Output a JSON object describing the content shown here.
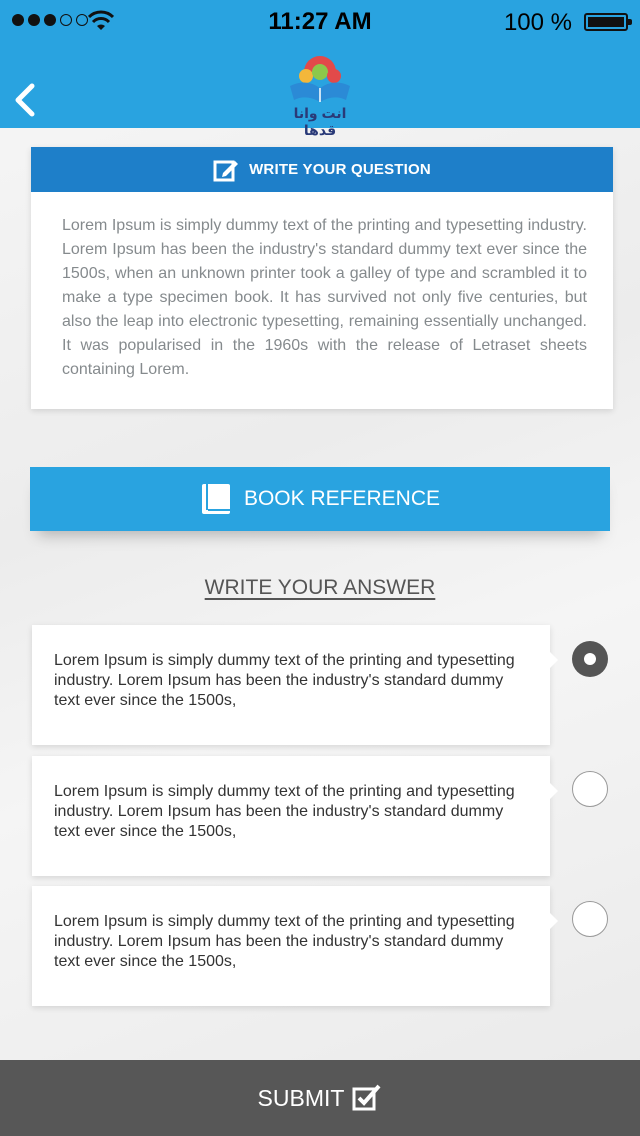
{
  "status_bar": {
    "time": "11:27 AM",
    "battery_percent": "100 %"
  },
  "header": {
    "logo_text": "انت وانا قدها",
    "brand_color": "#29a3e0"
  },
  "question": {
    "heading": "WRITE YOUR QUESTION",
    "text": "Lorem Ipsum is simply dummy text of the printing and typesetting industry. Lorem Ipsum has been the industry's standard dummy text ever since the 1500s, when an unknown printer took a galley of type and scrambled it to make a type specimen book. It has survived not only five centuries, but also the leap into electronic typesetting, remaining essentially unchanged. It was popularised in the 1960s with the release of Letraset sheets containing Lorem."
  },
  "book_reference": {
    "label": "BOOK REFERENCE"
  },
  "answers": {
    "title": "WRITE YOUR ANSWER",
    "options": [
      {
        "text": "Lorem Ipsum is simply dummy text of the printing and typesetting industry. Lorem Ipsum has been the industry's standard dummy text ever since the 1500s,",
        "selected": true
      },
      {
        "text": "Lorem Ipsum is simply dummy text of the printing and typesetting industry. Lorem Ipsum has been the industry's standard dummy text ever since the 1500s,",
        "selected": false
      },
      {
        "text": "Lorem Ipsum is simply dummy text of the printing and typesetting industry. Lorem Ipsum has been the industry's standard dummy text ever since the 1500s,",
        "selected": false
      }
    ]
  },
  "submit": {
    "label": "SUBMIT"
  }
}
